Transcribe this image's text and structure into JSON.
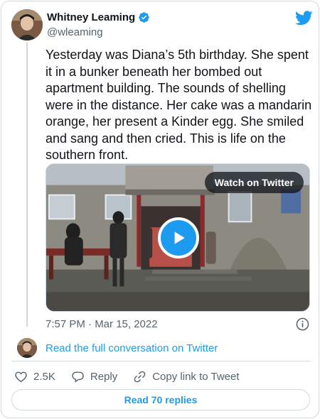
{
  "author": {
    "name": "Whitney Leaming",
    "handle": "@wleaming",
    "verified": true
  },
  "tweet": {
    "text": "Yesterday was Diana’s 5th birthday. She spent it in a bunker beneath her bombed out apartment building. The sounds of shelling were in the distance. Her cake was a mandarin orange, her present a Kinder egg. She smiled and sang and then cried. This is life on the southern front.",
    "timestamp": "7:57 PM · Mar 15, 2022"
  },
  "media": {
    "watch_label": "Watch on Twitter"
  },
  "conversation": {
    "link_label": "Read the full conversation on Twitter"
  },
  "actions": {
    "likes": "2.5K",
    "reply_label": "Reply",
    "copy_label": "Copy link to Tweet"
  },
  "footer": {
    "read_replies_label": "Read 70 replies"
  },
  "icons": {
    "brand": "twitter-bird-icon",
    "verified": "verified-badge-icon",
    "like": "heart-icon",
    "reply": "reply-bubble-icon",
    "copy": "link-icon",
    "info": "info-icon",
    "play": "play-icon"
  },
  "colors": {
    "accent": "#1d9bf0",
    "text": "#0f1419",
    "muted": "#536471",
    "border": "#cfd9de"
  }
}
